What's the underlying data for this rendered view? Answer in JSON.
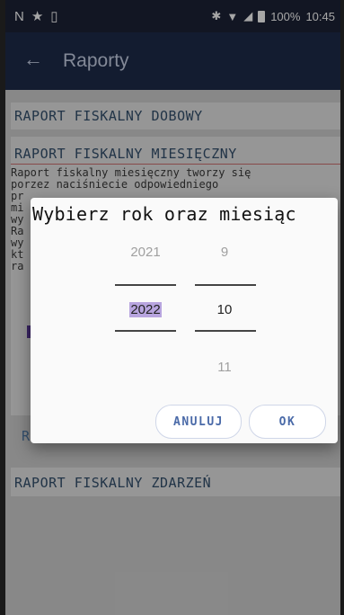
{
  "status_bar": {
    "battery": "100%",
    "time": "10:45"
  },
  "app_bar": {
    "title": "Raporty"
  },
  "reports": {
    "dobowy_title": "RAPORT FISKALNY DOBOWY",
    "miesieczny_title": "RAPORT FISKALNY MIESIĘCZNY",
    "miesieczny_desc_visible": "Raport fiskalny miesięczny tworzy się\nporzez naciśniecie odpowiedniego\npr\nmi\nwy\nRa\nwy\nkt                                          en\nra",
    "zdarzen_title": "RAPORT FISKALNY ZDARZEŃ",
    "behind_dialog_letter": "R"
  },
  "dialog": {
    "title": "Wybierz rok oraz miesiąc",
    "year_prev": "2021",
    "year_selected": "2022",
    "month_prev": "9",
    "month_selected": "10",
    "month_next": "11",
    "cancel_label": "ANULUJ",
    "ok_label": "OK"
  },
  "colors": {
    "status_bar": "#1c2336",
    "app_bar": "#1e2b4a",
    "accent": "#4a6aa8",
    "selection_highlight": "#b8a5df"
  }
}
